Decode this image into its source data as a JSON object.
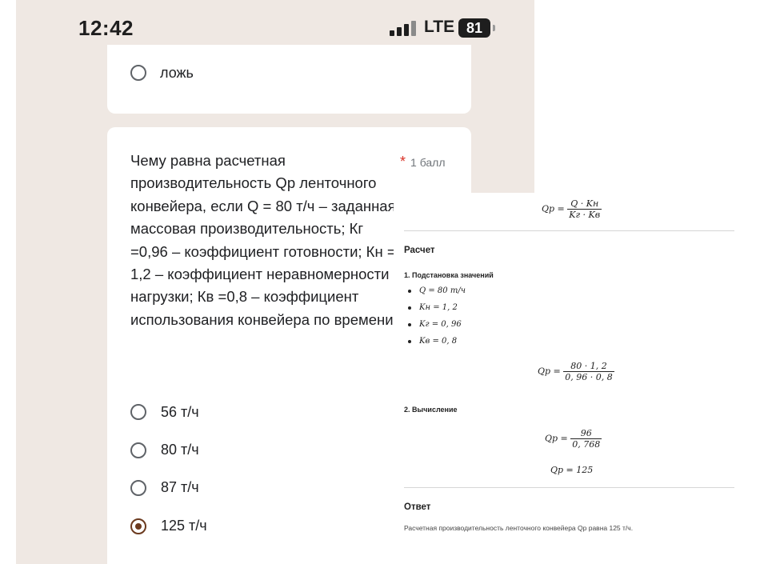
{
  "status_bar": {
    "time": "12:42",
    "network": "LTE",
    "battery": "81"
  },
  "prev_question": {
    "option_label": "ложь"
  },
  "question": {
    "text": "Чему равна расчетная производительность Qр ленточного конвейера, если Q = 80 т/ч – заданная массовая производительность; Кг =0,96 – коэффициент готовности; Кн = 1,2 – коэффициент неравномерности нагрузки; Кв =0,8 – коэффициент использования конвейера по времени?",
    "required_mark": "*",
    "points": "1 балл",
    "options": [
      {
        "label": "56 т/ч",
        "selected": false
      },
      {
        "label": "80 т/ч",
        "selected": false
      },
      {
        "label": "87 т/ч",
        "selected": false
      },
      {
        "label": "125 т/ч",
        "selected": true
      }
    ]
  },
  "solution": {
    "formula": {
      "lhs": "Qр =",
      "num": "Q · Kн",
      "den": "Kг · Kв"
    },
    "calc_heading": "Расчет",
    "step1_heading": "1. Подстановка значений",
    "values": [
      "Q = 80 т/ч",
      "Kн = 1, 2",
      "Kг = 0, 96",
      "Kв = 0, 8"
    ],
    "subst": {
      "lhs": "Qр =",
      "num": "80 · 1, 2",
      "den": "0, 96 · 0, 8"
    },
    "step2_heading": "2. Вычисление",
    "calc": {
      "lhs": "Qр =",
      "num": "96",
      "den": "0, 768"
    },
    "result": "Qр = 125",
    "answer_heading": "Ответ",
    "answer_text": "Расчетная производительность ленточного конвейера Qр равна 125 т/ч."
  },
  "colors": {
    "phone_bg": "#efe8e3",
    "card_bg": "#ffffff",
    "radio_selected": "#6b3a1f",
    "required": "#d93025"
  }
}
